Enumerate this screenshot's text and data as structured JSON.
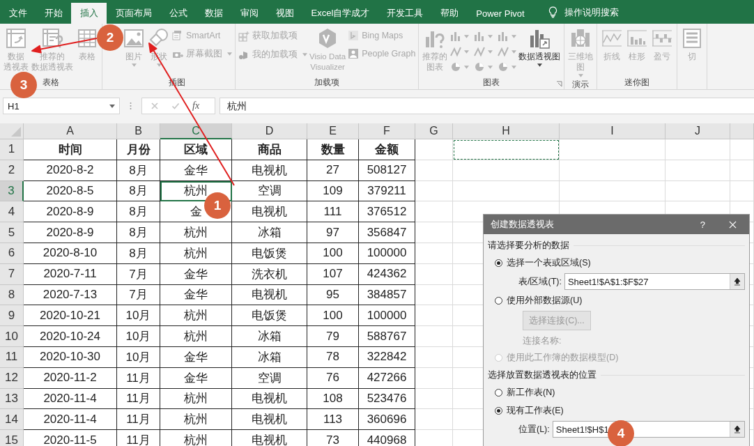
{
  "menu_tabs": [
    {
      "label": "文件",
      "selected": false
    },
    {
      "label": "开始",
      "selected": false
    },
    {
      "label": "插入",
      "selected": true
    },
    {
      "label": "页面布局",
      "selected": false
    },
    {
      "label": "公式",
      "selected": false
    },
    {
      "label": "数据",
      "selected": false
    },
    {
      "label": "审阅",
      "selected": false
    },
    {
      "label": "视图",
      "selected": false
    },
    {
      "label": "Excel自学成才",
      "selected": false
    },
    {
      "label": "开发工具",
      "selected": false
    },
    {
      "label": "帮助",
      "selected": false
    },
    {
      "label": "Power Pivot",
      "selected": false
    }
  ],
  "tell_me": {
    "placeholder": "操作说明搜索"
  },
  "ribbon": {
    "groups": [
      {
        "label": "表格",
        "launcher": false,
        "items": [
          {
            "kind": "large",
            "lines": [
              "数据",
              "透视表"
            ],
            "disabled": true,
            "dropdown": false
          },
          {
            "kind": "large",
            "lines": [
              "推荐的",
              "数据透视表"
            ],
            "disabled": true,
            "dropdown": false
          },
          {
            "kind": "large",
            "lines": [
              "表格"
            ],
            "disabled": true,
            "dropdown": false
          }
        ]
      },
      {
        "label": "插图",
        "launcher": false,
        "items": [
          {
            "kind": "large",
            "lines": [
              "图片"
            ],
            "disabled": true,
            "dropdown": true
          },
          {
            "kind": "large",
            "lines": [
              "形状"
            ],
            "disabled": true,
            "dropdown": true
          },
          {
            "kind": "stack",
            "entries": [
              {
                "label": "SmartArt",
                "disabled": true,
                "dropdown": false
              },
              {
                "label": "屏幕截图",
                "disabled": true,
                "dropdown": true
              }
            ]
          }
        ]
      },
      {
        "label": "加载项",
        "launcher": false,
        "items": [
          {
            "kind": "stack",
            "entries": [
              {
                "label": "获取加载项",
                "disabled": true,
                "dropdown": false
              },
              {
                "label": "我的加载项",
                "disabled": true,
                "dropdown": true
              }
            ]
          },
          {
            "kind": "large",
            "lines": [
              "Visio Data",
              "Visualizer"
            ],
            "disabled": true,
            "dropdown": false
          },
          {
            "kind": "stack",
            "entries": [
              {
                "label": "Bing Maps",
                "disabled": true,
                "dropdown": false
              },
              {
                "label": "People Graph",
                "disabled": true,
                "dropdown": false
              }
            ]
          }
        ]
      },
      {
        "label": "图表",
        "launcher": true,
        "items": [
          {
            "kind": "large",
            "lines": [
              "推荐的",
              "图表"
            ],
            "disabled": true,
            "dropdown": false
          },
          {
            "kind": "grid",
            "entries": [
              {
                "dropdown": true
              },
              {
                "dropdown": true
              },
              {
                "dropdown": true
              },
              {
                "dropdown": true
              },
              {
                "dropdown": true
              },
              {
                "dropdown": true
              },
              {
                "dropdown": true
              },
              {
                "dropdown": true
              },
              {
                "dropdown": true
              }
            ]
          },
          {
            "kind": "large",
            "lines": [
              "数据透视图"
            ],
            "disabled": false,
            "dropdown": true
          }
        ]
      },
      {
        "label": "演示",
        "launcher": false,
        "items": [
          {
            "kind": "large",
            "lines": [
              "三维地",
              "图"
            ],
            "disabled": true,
            "dropdown": true
          }
        ]
      },
      {
        "label": "迷你图",
        "launcher": false,
        "items": [
          {
            "kind": "large",
            "lines": [
              "折线"
            ],
            "disabled": true,
            "dropdown": false
          },
          {
            "kind": "large",
            "lines": [
              "柱形"
            ],
            "disabled": true,
            "dropdown": false
          },
          {
            "kind": "large",
            "lines": [
              "盈亏"
            ],
            "disabled": true,
            "dropdown": false
          }
        ]
      },
      {
        "launcher": false,
        "items": [
          {
            "kind": "large",
            "lines": [
              "切"
            ],
            "disabled": true,
            "dropdown": false
          }
        ]
      }
    ]
  },
  "formula_bar": {
    "name_box": "H1",
    "function_label": "fx",
    "value": "杭州"
  },
  "sheet": {
    "columns": [
      {
        "label": "A",
        "selected": false,
        "marquee": false
      },
      {
        "label": "B",
        "selected": false,
        "marquee": false
      },
      {
        "label": "C",
        "selected": true,
        "marquee": false
      },
      {
        "label": "D",
        "selected": false,
        "marquee": false
      },
      {
        "label": "E",
        "selected": false,
        "marquee": false
      },
      {
        "label": "F",
        "selected": false,
        "marquee": false
      },
      {
        "label": "G",
        "selected": false,
        "marquee": false
      },
      {
        "label": "H",
        "selected": false,
        "marquee": true
      },
      {
        "label": "I",
        "selected": false,
        "marquee": false
      },
      {
        "label": "J",
        "selected": false,
        "marquee": false
      }
    ],
    "rows": [
      {
        "header": "1",
        "kind": "header",
        "selected": false,
        "cells": [
          "时间",
          "月份",
          "区域",
          "商品",
          "数量",
          "金额"
        ]
      },
      {
        "header": "2",
        "kind": "data",
        "selected": false,
        "cells": [
          "2020-8-2",
          "8月",
          "金华",
          "电视机",
          "27",
          "508127"
        ]
      },
      {
        "header": "3",
        "kind": "data",
        "selected": true,
        "cells": [
          "2020-8-5",
          "8月",
          "杭州",
          "空调",
          "109",
          "379211"
        ]
      },
      {
        "header": "4",
        "kind": "data",
        "selected": false,
        "cells": [
          "2020-8-9",
          "8月",
          "金",
          "电视机",
          "111",
          "376512"
        ]
      },
      {
        "header": "5",
        "kind": "data",
        "selected": false,
        "cells": [
          "2020-8-9",
          "8月",
          "杭州",
          "冰箱",
          "97",
          "356847"
        ]
      },
      {
        "header": "6",
        "kind": "data",
        "selected": false,
        "cells": [
          "2020-8-10",
          "8月",
          "杭州",
          "电饭煲",
          "100",
          "100000"
        ]
      },
      {
        "header": "7",
        "kind": "data",
        "selected": false,
        "cells": [
          "2020-7-11",
          "7月",
          "金华",
          "洗衣机",
          "107",
          "424362"
        ]
      },
      {
        "header": "8",
        "kind": "data",
        "selected": false,
        "cells": [
          "2020-7-13",
          "7月",
          "金华",
          "电视机",
          "95",
          "384857"
        ]
      },
      {
        "header": "9",
        "kind": "data",
        "selected": false,
        "cells": [
          "2020-10-21",
          "10月",
          "杭州",
          "电饭煲",
          "100",
          "100000"
        ]
      },
      {
        "header": "10",
        "kind": "data",
        "selected": false,
        "cells": [
          "2020-10-24",
          "10月",
          "杭州",
          "冰箱",
          "79",
          "588767"
        ]
      },
      {
        "header": "11",
        "kind": "data",
        "selected": false,
        "cells": [
          "2020-10-30",
          "10月",
          "金华",
          "冰箱",
          "78",
          "322842"
        ]
      },
      {
        "header": "12",
        "kind": "data",
        "selected": false,
        "cells": [
          "2020-11-2",
          "11月",
          "金华",
          "空调",
          "76",
          "427266"
        ]
      },
      {
        "header": "13",
        "kind": "data",
        "selected": false,
        "cells": [
          "2020-11-4",
          "11月",
          "杭州",
          "电视机",
          "108",
          "523476"
        ]
      },
      {
        "header": "14",
        "kind": "data",
        "selected": false,
        "cells": [
          "2020-11-4",
          "11月",
          "杭州",
          "电视机",
          "113",
          "360696"
        ]
      },
      {
        "header": "15",
        "kind": "data",
        "selected": false,
        "cells": [
          "2020-11-5",
          "11月",
          "杭州",
          "电视机",
          "73",
          "440968"
        ]
      }
    ]
  },
  "dialog": {
    "title": "创建数据透视表",
    "help": "?",
    "sections": [
      {
        "heading": "请选择要分析的数据",
        "options": [
          {
            "kind": "radio",
            "label": "选择一个表或区域(S)",
            "selected": true,
            "disabled": false
          },
          {
            "kind": "field",
            "label": "表/区域(T):",
            "value": "Sheet1!$A$1:$F$27"
          },
          {
            "kind": "radio",
            "label": "使用外部数据源(U)",
            "selected": false,
            "disabled": false
          },
          {
            "kind": "button",
            "label": "选择连接(C)..."
          },
          {
            "kind": "note",
            "label": "连接名称:"
          },
          {
            "kind": "radio",
            "label": "使用此工作簿的数据模型(D)",
            "selected": false,
            "disabled": true
          }
        ]
      },
      {
        "heading": "选择放置数据透视表的位置",
        "options": [
          {
            "kind": "radio",
            "label": "新工作表(N)",
            "selected": false,
            "disabled": false
          },
          {
            "kind": "radio",
            "label": "现有工作表(E)",
            "selected": true,
            "disabled": false
          },
          {
            "kind": "field",
            "label": "位置(L):",
            "value": "Sheet1!$H$1"
          }
        ]
      }
    ]
  },
  "annotations": [
    {
      "label": "1"
    },
    {
      "label": "2"
    },
    {
      "label": "3"
    },
    {
      "label": "4"
    }
  ]
}
